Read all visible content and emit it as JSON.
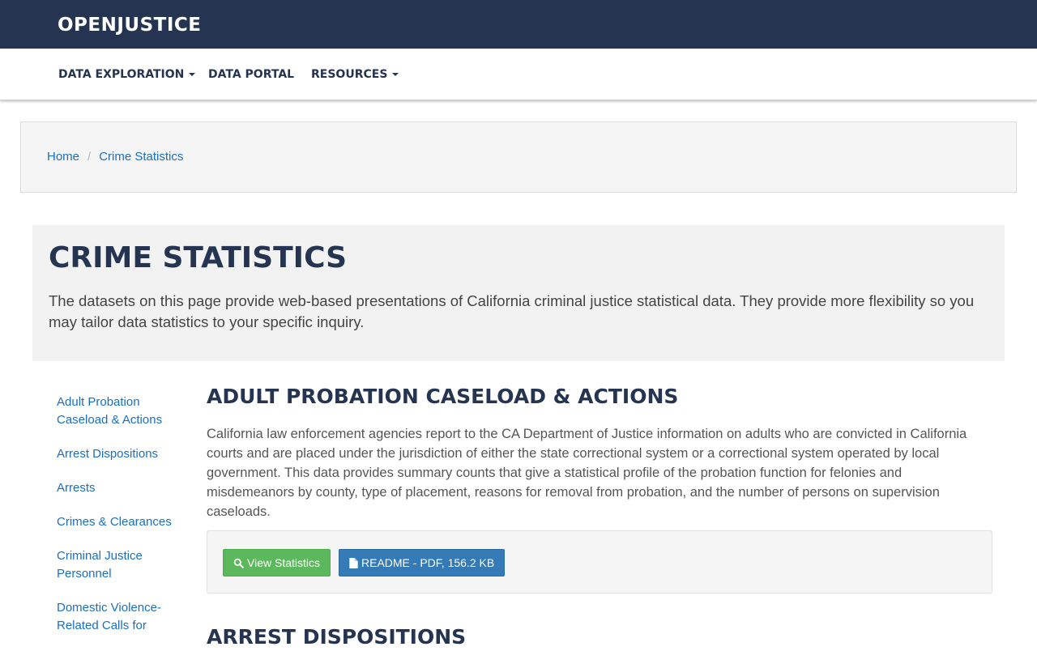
{
  "brand": {
    "logo": "OPENJUSTICE"
  },
  "nav": {
    "items": [
      {
        "label": "DATA EXPLORATION",
        "dropdown": true
      },
      {
        "label": "DATA PORTAL",
        "dropdown": false
      },
      {
        "label": "RESOURCES",
        "dropdown": true
      }
    ]
  },
  "breadcrumb": {
    "home": "Home",
    "current": "Crime Statistics"
  },
  "hero": {
    "title": "CRIME STATISTICS",
    "text": "The datasets on this page provide web-based presentations of California criminal justice statistical data. They provide more flexibility so you may tailor data statistics to your specific inquiry."
  },
  "sidebar": {
    "items": [
      "Adult Probation Caseload & Actions",
      "Arrest Dispositions",
      "Arrests",
      "Crimes & Clearances",
      "Criminal Justice Personnel",
      "Domestic Violence-Related Calls for"
    ]
  },
  "sections": [
    {
      "title": "ADULT PROBATION CASELOAD & ACTIONS",
      "description": "California law enforcement agencies report to the CA Department of Justice information on adults who are convicted in California courts and are placed under the jurisdiction of either the state correctional system or a correctional system operated by local government. This data provides summary counts that give a statistical profile of the probation function for felonies and misdemeanors by county, type of placement, reasons for removal from probation, and the number of persons on supervision caseloads.",
      "view_button": "View Statistics",
      "readme_button": "README - PDF, 156.2 KB"
    },
    {
      "title": "ARREST DISPOSITIONS"
    }
  ],
  "colors": {
    "header_bg": "#253551",
    "link": "#1a6fc1",
    "btn_green": "#5cb85c",
    "btn_blue": "#337ab7"
  },
  "icons": {
    "view": "search-icon",
    "readme": "file-icon"
  }
}
